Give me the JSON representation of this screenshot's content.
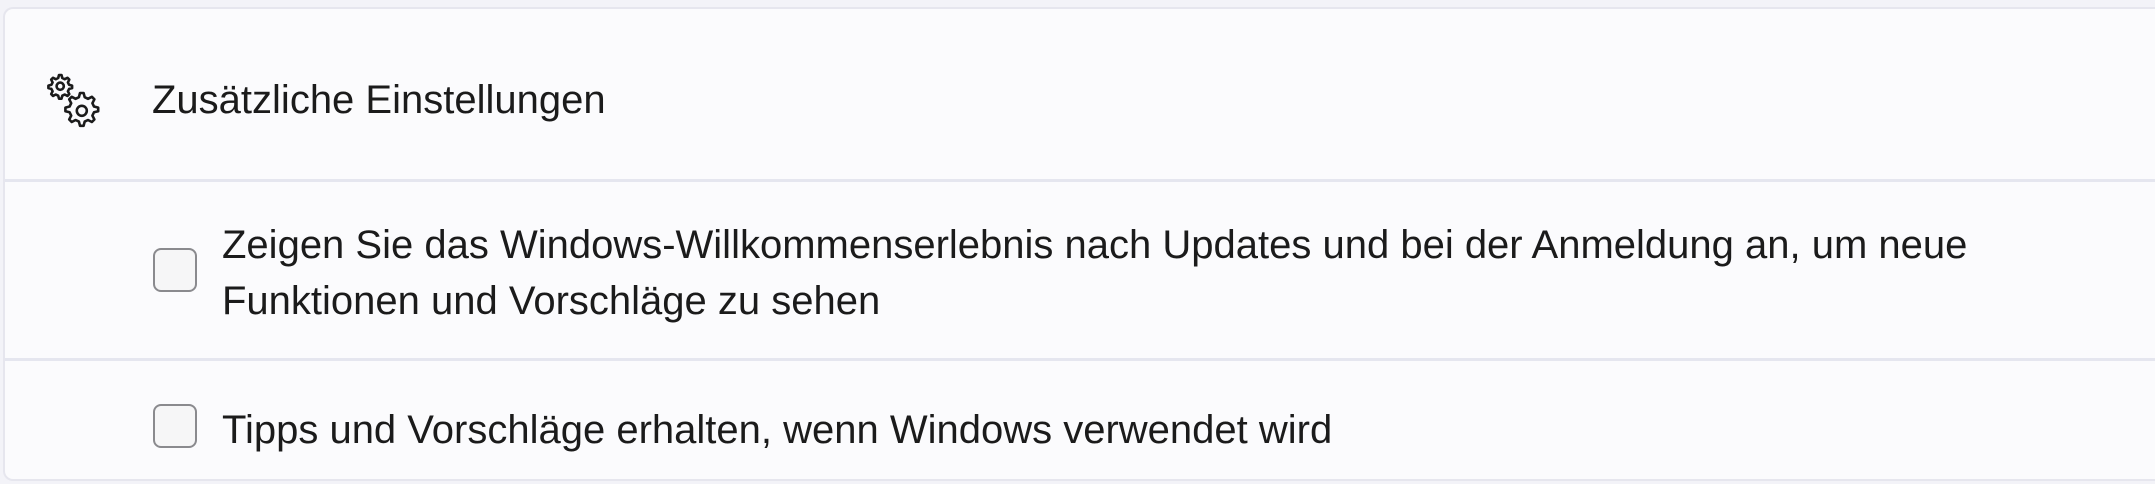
{
  "section": {
    "icon": "gear-icon",
    "title": "Zusätzliche Einstellungen"
  },
  "options": [
    {
      "label": "Zeigen Sie das Windows-Willkommenserlebnis nach Updates und bei der Anmeldung an, um neue Funktionen und Vorschläge zu sehen",
      "checked": false
    },
    {
      "label": "Tipps und Vorschläge erhalten, wenn Windows verwendet wird",
      "checked": false
    }
  ]
}
